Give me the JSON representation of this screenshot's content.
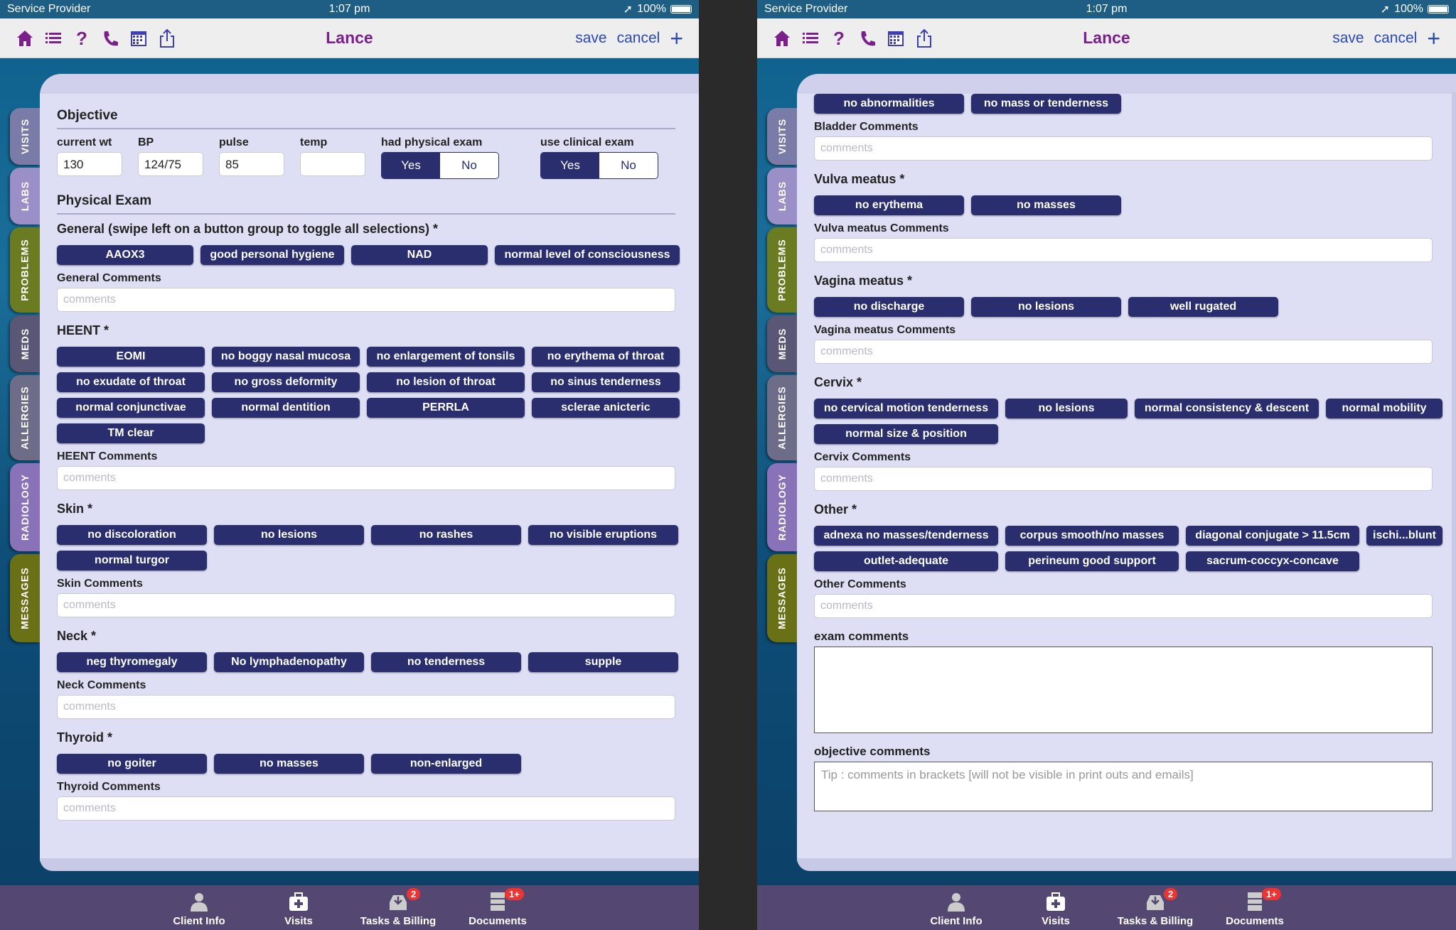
{
  "status": {
    "carrier": "Service Provider",
    "time": "1:07 pm",
    "battery": "100%"
  },
  "nav": {
    "title": "Lance",
    "save": "save",
    "cancel": "cancel",
    "add": "+"
  },
  "side_tabs": [
    "VISITS",
    "LABS",
    "PROBLEMS",
    "MEDS",
    "ALLERGIES",
    "RADIOLOGY",
    "MESSAGES"
  ],
  "tabbar": {
    "client_info": "Client Info",
    "visits": "Visits",
    "tasks": "Tasks & Billing",
    "tasks_badge": "2",
    "documents": "Documents",
    "documents_badge": "1+"
  },
  "left": {
    "objective_title": "Objective",
    "vitals": {
      "wt_label": "current wt",
      "wt_value": "130",
      "bp_label": "BP",
      "bp_value": "124/75",
      "pulse_label": "pulse",
      "pulse_value": "85",
      "temp_label": "temp",
      "temp_value": "",
      "physical_label": "had physical exam",
      "clinical_label": "use clinical exam",
      "yes": "Yes",
      "no": "No"
    },
    "physical_title": "Physical Exam",
    "general_label": "General     (swipe left on a button group to toggle all selections) *",
    "general_buttons": [
      "AAOX3",
      "good personal hygiene",
      "NAD",
      "normal level of consciousness"
    ],
    "general_comments": "General Comments",
    "heent_label": "HEENT *",
    "heent_buttons": [
      "EOMI",
      "no boggy nasal mucosa",
      "no enlargement of tonsils",
      "no erythema of throat",
      "no exudate of throat",
      "no gross deformity",
      "no lesion of throat",
      "no sinus tenderness",
      "normal conjunctivae",
      "normal dentition",
      "PERRLA",
      "sclerae anicteric",
      "TM clear"
    ],
    "heent_comments": "HEENT Comments",
    "skin_label": "Skin *",
    "skin_buttons": [
      "no discoloration",
      "no lesions",
      "no rashes",
      "no visible eruptions",
      "normal turgor"
    ],
    "skin_comments": "Skin Comments",
    "neck_label": "Neck *",
    "neck_buttons": [
      "neg thyromegaly",
      "No lymphadenopathy",
      "no tenderness",
      "supple"
    ],
    "neck_comments": "Neck Comments",
    "thyroid_label": "Thyroid *",
    "thyroid_buttons": [
      "no goiter",
      "no masses",
      "non-enlarged"
    ],
    "thyroid_comments": "Thyroid Comments",
    "placeholder": "comments"
  },
  "right": {
    "top_buttons": [
      "no abnormalities",
      "no mass or tenderness"
    ],
    "bladder_comments": "Bladder Comments",
    "vulva_label": "Vulva meatus *",
    "vulva_buttons": [
      "no erythema",
      "no masses"
    ],
    "vulva_comments": "Vulva meatus Comments",
    "vagina_label": "Vagina meatus *",
    "vagina_buttons": [
      "no discharge",
      "no lesions",
      "well rugated"
    ],
    "vagina_comments": "Vagina meatus Comments",
    "cervix_label": "Cervix *",
    "cervix_buttons": [
      "no cervical motion tenderness",
      "no lesions",
      "normal consistency & descent",
      "normal mobility",
      "normal size & position"
    ],
    "cervix_comments": "Cervix Comments",
    "other_label": "Other *",
    "other_buttons": [
      "adnexa no masses/tenderness",
      "corpus smooth/no masses",
      "diagonal conjugate > 11.5cm",
      "ischi...blunt",
      "outlet-adequate",
      "perineum good support",
      "sacrum-coccyx-concave"
    ],
    "other_comments": "Other Comments",
    "exam_comments": "exam comments",
    "objective_comments": "objective comments",
    "tip": "Tip : comments in brackets [will not be visible in print outs and emails]",
    "placeholder": "comments"
  }
}
